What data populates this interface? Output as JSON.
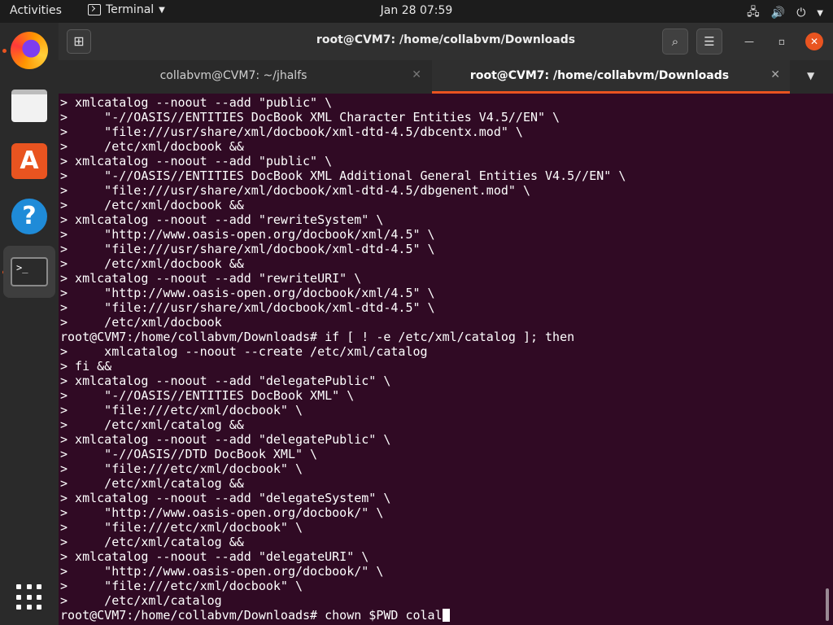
{
  "topbar": {
    "activities": "Activities",
    "app_name": "Terminal",
    "clock": "Jan 28  07:59"
  },
  "window": {
    "title": "root@CVM7: /home/collabvm/Downloads"
  },
  "tabs": [
    {
      "label": "collabvm@CVM7: ~/jhalfs",
      "active": false
    },
    {
      "label": "root@CVM7: /home/collabvm/Downloads",
      "active": true
    }
  ],
  "dock": {
    "items": [
      "firefox-icon",
      "files-icon",
      "software-store-icon",
      "help-icon",
      "terminal-icon"
    ],
    "terminal_glyph": ">_"
  },
  "terminal": {
    "lines": [
      "> xmlcatalog --noout --add \"public\" \\",
      ">     \"-//OASIS//ENTITIES DocBook XML Character Entities V4.5//EN\" \\",
      ">     \"file:///usr/share/xml/docbook/xml-dtd-4.5/dbcentx.mod\" \\",
      ">     /etc/xml/docbook &&",
      "> xmlcatalog --noout --add \"public\" \\",
      ">     \"-//OASIS//ENTITIES DocBook XML Additional General Entities V4.5//EN\" \\",
      ">     \"file:///usr/share/xml/docbook/xml-dtd-4.5/dbgenent.mod\" \\",
      ">     /etc/xml/docbook &&",
      "> xmlcatalog --noout --add \"rewriteSystem\" \\",
      ">     \"http://www.oasis-open.org/docbook/xml/4.5\" \\",
      ">     \"file:///usr/share/xml/docbook/xml-dtd-4.5\" \\",
      ">     /etc/xml/docbook &&",
      "> xmlcatalog --noout --add \"rewriteURI\" \\",
      ">     \"http://www.oasis-open.org/docbook/xml/4.5\" \\",
      ">     \"file:///usr/share/xml/docbook/xml-dtd-4.5\" \\",
      ">     /etc/xml/docbook",
      "root@CVM7:/home/collabvm/Downloads# if [ ! -e /etc/xml/catalog ]; then",
      ">     xmlcatalog --noout --create /etc/xml/catalog",
      "> fi &&",
      "> xmlcatalog --noout --add \"delegatePublic\" \\",
      ">     \"-//OASIS//ENTITIES DocBook XML\" \\",
      ">     \"file:///etc/xml/docbook\" \\",
      ">     /etc/xml/catalog &&",
      "> xmlcatalog --noout --add \"delegatePublic\" \\",
      ">     \"-//OASIS//DTD DocBook XML\" \\",
      ">     \"file:///etc/xml/docbook\" \\",
      ">     /etc/xml/catalog &&",
      "> xmlcatalog --noout --add \"delegateSystem\" \\",
      ">     \"http://www.oasis-open.org/docbook/\" \\",
      ">     \"file:///etc/xml/docbook\" \\",
      ">     /etc/xml/catalog &&",
      "> xmlcatalog --noout --add \"delegateURI\" \\",
      ">     \"http://www.oasis-open.org/docbook/\" \\",
      ">     \"file:///etc/xml/docbook\" \\",
      ">     /etc/xml/catalog"
    ],
    "prompt_line": "root@CVM7:/home/collabvm/Downloads# chown $PWD colal"
  },
  "colors": {
    "terminal_bg": "#300a24",
    "accent": "#e95420"
  }
}
